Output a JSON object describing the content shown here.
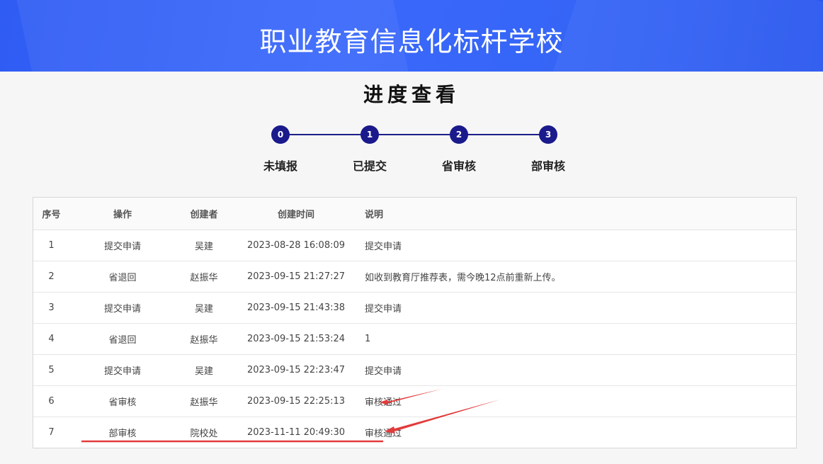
{
  "header": {
    "title": "职业教育信息化标杆学校"
  },
  "page": {
    "title": "进度查看"
  },
  "steps": [
    {
      "num": "0",
      "label": "未填报"
    },
    {
      "num": "1",
      "label": "已提交"
    },
    {
      "num": "2",
      "label": "省审核"
    },
    {
      "num": "3",
      "label": "部审核"
    }
  ],
  "table": {
    "columns": [
      "序号",
      "操作",
      "创建者",
      "创建时间",
      "说明"
    ],
    "rows": [
      [
        "1",
        "提交申请",
        "吴建",
        "2023-08-28 16:08:09",
        "提交申请"
      ],
      [
        "2",
        "省退回",
        "赵振华",
        "2023-09-15 21:27:27",
        "如收到教育厅推荐表，需今晚12点前重新上传。"
      ],
      [
        "3",
        "提交申请",
        "吴建",
        "2023-09-15 21:43:38",
        "提交申请"
      ],
      [
        "4",
        "省退回",
        "赵振华",
        "2023-09-15 21:53:24",
        "1"
      ],
      [
        "5",
        "提交申请",
        "吴建",
        "2023-09-15 22:23:47",
        "提交申请"
      ],
      [
        "6",
        "省审核",
        "赵振华",
        "2023-09-15 22:25:13",
        "审核通过"
      ],
      [
        "7",
        "部审核",
        "院校处",
        "2023-11-11 20:49:30",
        "审核通过"
      ]
    ]
  },
  "colors": {
    "banner": "#3565f6",
    "step": "#1a1a8c",
    "annotation": "#e23b3b"
  }
}
